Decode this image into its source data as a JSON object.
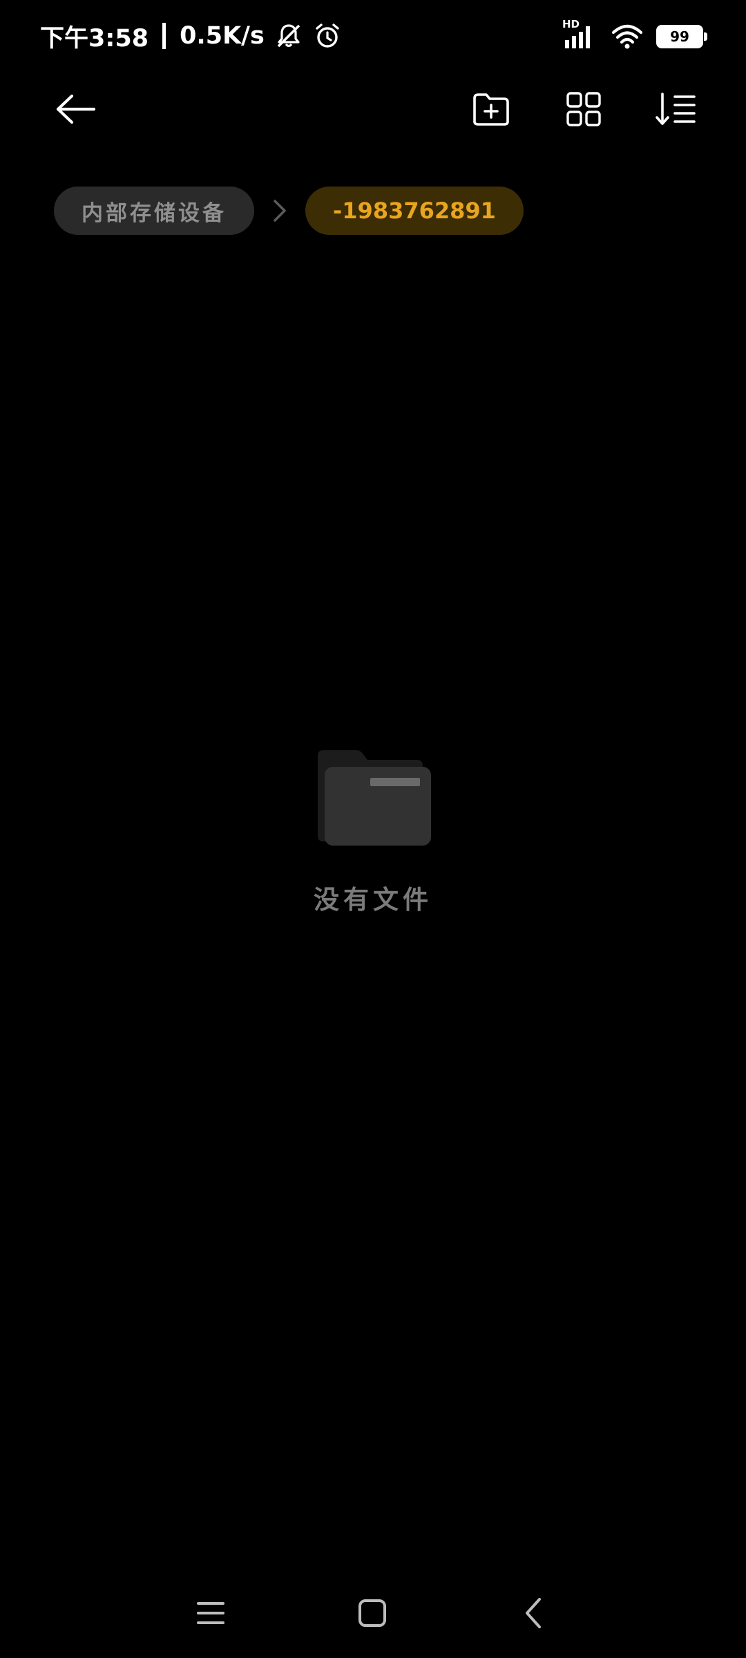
{
  "status_bar": {
    "time": "下午3:58",
    "net_speed": "0.5K/s",
    "signal_label": "HD",
    "battery": "99",
    "icons": [
      "mute-bell-icon",
      "alarm-icon",
      "hd-signal-icon",
      "wifi-icon",
      "battery-icon"
    ]
  },
  "toolbar": {
    "icons": [
      "back-arrow-icon",
      "new-folder-icon",
      "grid-view-icon",
      "sort-icon"
    ]
  },
  "breadcrumb": {
    "root": "内部存储设备",
    "current": "-1983762891"
  },
  "empty_state": {
    "message": "没有文件",
    "icon": "empty-folder-icon"
  },
  "navbar": {
    "icons": [
      "nav-menu-icon",
      "nav-home-icon",
      "nav-back-icon"
    ]
  },
  "colors": {
    "background": "#000000",
    "accent": "#e8a51f",
    "accent_bg": "#3d2d05",
    "chip_bg": "#2a2a2a",
    "muted_text": "#8f8f8f"
  }
}
